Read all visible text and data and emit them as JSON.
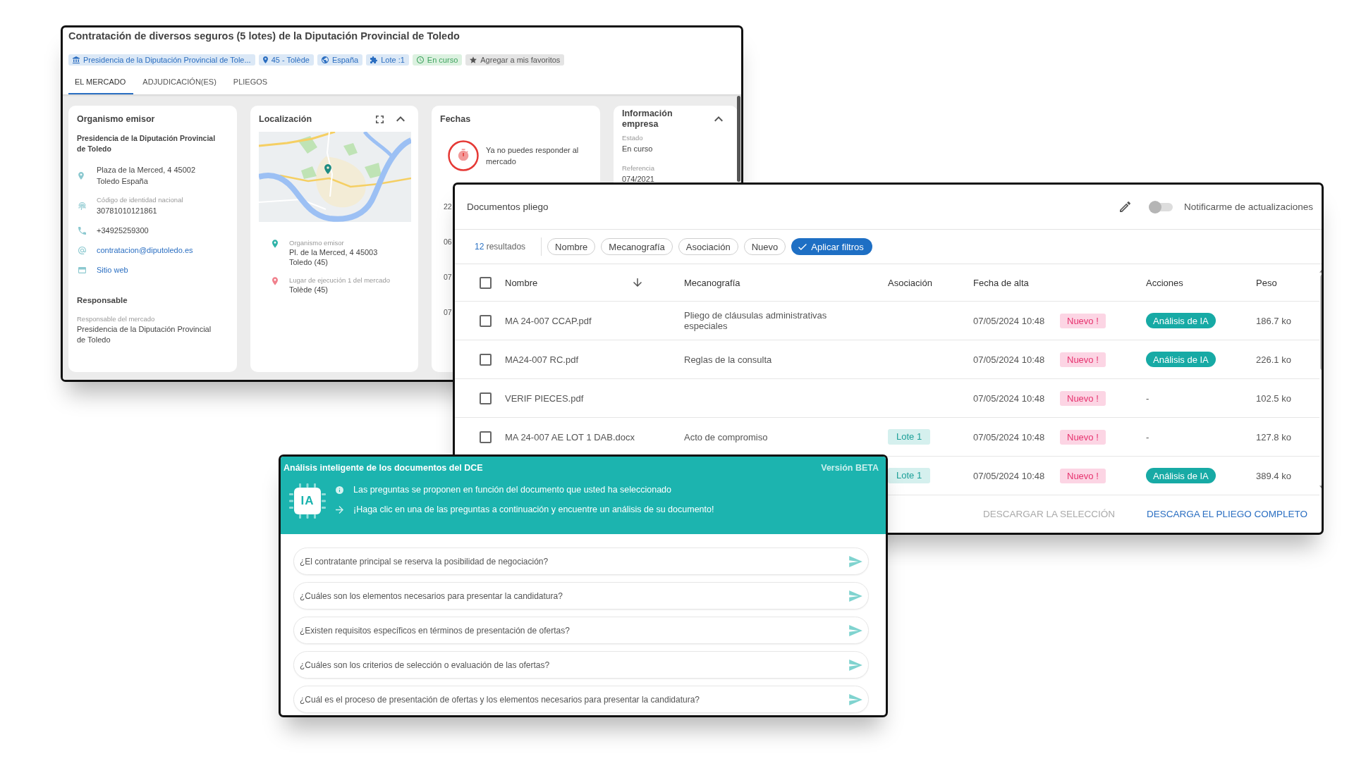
{
  "procurement": {
    "title": "Contratación de diversos seguros (5 lotes) de la Diputación Provincial de Toledo",
    "tags": [
      {
        "kind": "organization",
        "label": "Presidencia de la Diputación Provincial de Tole..."
      },
      {
        "kind": "location",
        "label": "45 - Tolède"
      },
      {
        "kind": "country",
        "label": "España"
      },
      {
        "kind": "lot",
        "label": "Lote :1"
      },
      {
        "kind": "status",
        "label": "En curso"
      },
      {
        "kind": "favorite",
        "label": "Agregar a mis favoritos"
      }
    ],
    "tabs": [
      {
        "label": "EL MERCADO",
        "selected": true
      },
      {
        "label": "ADJUDICACIÓN(ES)",
        "selected": false
      },
      {
        "label": "PLIEGOS",
        "selected": false
      }
    ],
    "issuer_card": {
      "title": "Organismo emisor",
      "name": "Presidencia de la Diputación Provincial de Toledo",
      "details": [
        {
          "kind": "address",
          "lines": [
            "Plaza de la Merced, 4 45002",
            "Toledo España"
          ]
        },
        {
          "kind": "id",
          "label": "Código de identidad nacional",
          "lines": [
            "30781010121861"
          ]
        },
        {
          "kind": "phone",
          "lines": [
            "+34925259300"
          ]
        },
        {
          "kind": "email",
          "lines": [
            "contratacion@diputoledo.es"
          ]
        },
        {
          "kind": "website",
          "lines": [
            "Sitio web"
          ]
        }
      ],
      "responsible_title": "Responsable",
      "responsible_label": "Responsable del mercado",
      "responsible_name": "Presidencia de la Diputación Provincial de Toledo"
    },
    "location_card": {
      "title": "Localización",
      "expanded": true,
      "places": [
        {
          "kind": "issuer",
          "label": "Organismo emisor",
          "lines": [
            "Pl. de la Merced, 4 45003",
            "Toledo (45)"
          ]
        },
        {
          "kind": "execution",
          "label": "Lugar de ejecución 1 del mercado",
          "lines": [
            "Tolède (45)"
          ]
        }
      ]
    },
    "dates_card": {
      "title": "Fechas",
      "notice": "Ya no puedes responder al mercado",
      "dates": [
        "22",
        "06",
        "07",
        "07"
      ]
    },
    "company_card": {
      "title": "Información empresa",
      "expanded": true,
      "fields": [
        {
          "label": "Estado",
          "value": "En curso"
        },
        {
          "label": "Referencia",
          "value": "074/2021"
        }
      ]
    }
  },
  "documents": {
    "title": "Documentos pliego",
    "notify": {
      "label": "Notificarme de actualizaciones",
      "on": false
    },
    "results": {
      "count": "12",
      "label": "resultados"
    },
    "filters": [
      {
        "label": "Nombre",
        "selected": false
      },
      {
        "label": "Mecanografía",
        "selected": false
      },
      {
        "label": "Asociación",
        "selected": false
      },
      {
        "label": "Nuevo",
        "selected": false
      }
    ],
    "apply_button": "Aplicar filtros",
    "table": {
      "all_checked": false,
      "columns": [
        {
          "label": "Nombre",
          "sorted": true
        },
        {
          "label": "Mecanografía",
          "sorted": false
        },
        {
          "label": "Asociación",
          "sorted": false
        },
        {
          "label": "Fecha de alta",
          "sorted": false
        },
        {
          "label": "Acciones",
          "sorted": false
        },
        {
          "label": "Peso",
          "sorted": false
        }
      ],
      "rows": [
        {
          "checked": false,
          "name": "MA 24-007 CCAP.pdf",
          "type": "Pliego de cláusulas administrativas especiales",
          "date": "07/05/2024 10:48",
          "badge": "Nuevo !",
          "action": {
            "kind": "ai_button",
            "label": "Análisis de IA"
          },
          "size": "186.7 ko"
        },
        {
          "checked": false,
          "name": "MA24-007 RC.pdf",
          "type": "Reglas de la consulta",
          "date": "07/05/2024 10:48",
          "badge": "Nuevo !",
          "action": {
            "kind": "ai_button",
            "label": "Análisis de IA"
          },
          "size": "226.1 ko"
        },
        {
          "checked": false,
          "name": "VERIF PIECES.pdf",
          "date": "07/05/2024 10:48",
          "badge": "Nuevo !",
          "action": {
            "kind": "text",
            "label": "-"
          },
          "size": "102.5 ko"
        },
        {
          "checked": false,
          "name": "MA 24-007 AE LOT 1 DAB.docx",
          "type": "Acto de compromiso",
          "lot": "Lote 1",
          "date": "07/05/2024 10:48",
          "badge": "Nuevo !",
          "action": {
            "kind": "text",
            "label": "-"
          },
          "size": "127.8 ko"
        },
        {
          "lot": "Lote 1",
          "date": "07/05/2024 10:48",
          "badge": "Nuevo !",
          "action": {
            "kind": "ai_button",
            "label": "Análisis de IA"
          },
          "size": "389.4 ko"
        }
      ]
    },
    "footer_buttons": [
      {
        "label": "DESCARGAR LA SELECCIÓN",
        "disabled": true
      },
      {
        "label": "DESCARGA EL PLIEGO COMPLETO",
        "disabled": false
      }
    ]
  },
  "ai_panel": {
    "title": "Análisis inteligente de los documentos del DCE",
    "version": "Versión BETA",
    "logo": "IA",
    "notes": [
      {
        "kind": "info",
        "text": "Las preguntas se proponen en función del documento que usted ha seleccionado"
      },
      {
        "kind": "arrow",
        "text": "¡Haga clic en una de las preguntas a continuación y encuentre un análisis de su documento!"
      }
    ],
    "questions": [
      "¿El contratante principal se reserva la posibilidad de negociación?",
      "¿Cuáles son los elementos necesarios para presentar la candidatura?",
      "¿Existen requisitos específicos en términos de presentación de ofertas?",
      "¿Cuáles son los criterios de selección o evaluación de las ofertas?",
      "¿Cuál es el proceso de presentación de ofertas y los elementos necesarios para presentar la candidatura?"
    ]
  }
}
